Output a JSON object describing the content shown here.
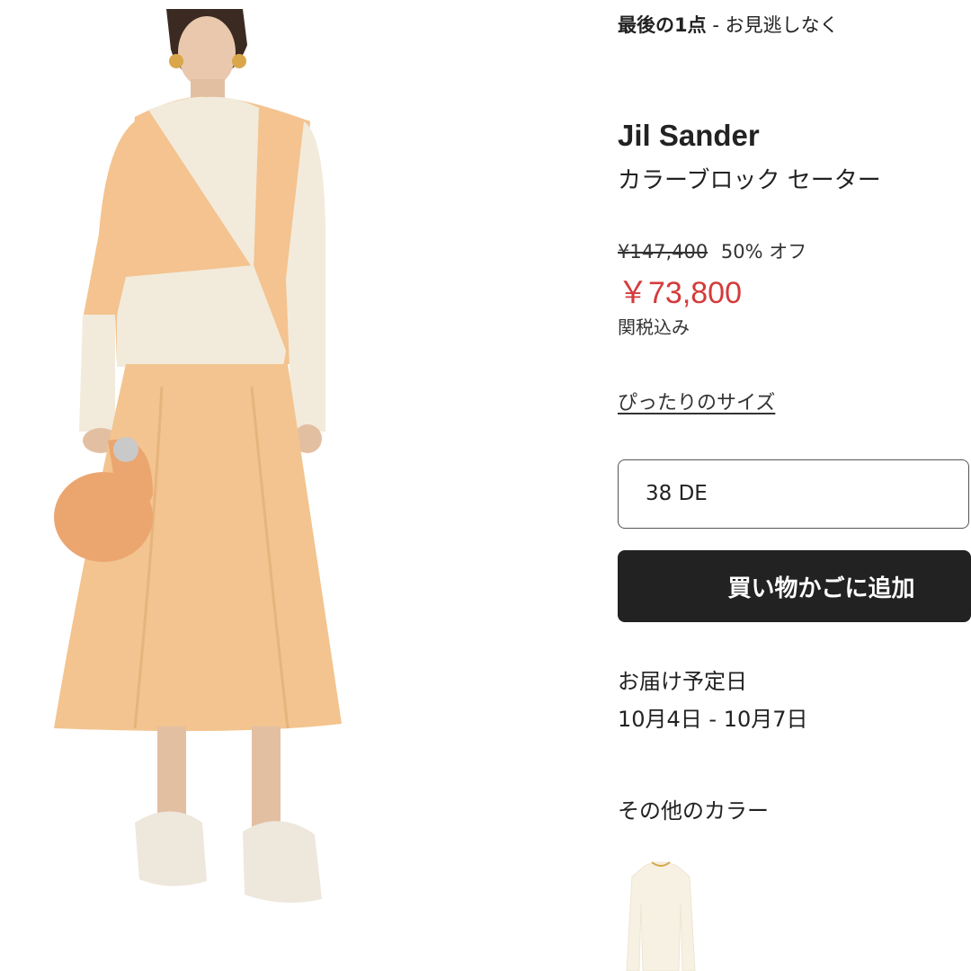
{
  "product_image": {
    "alt": "Jil Sander カラーブロック セーター",
    "colors": {
      "sweater_orange": "#f4c38f",
      "sweater_cream": "#f2ebdc",
      "skirt": "#f3c48f",
      "bag": "#eba670",
      "shoes": "#eee7dc"
    }
  },
  "urgency": {
    "strong": "最後の1点",
    "rest": "- お見逃しなく"
  },
  "product": {
    "brand": "Jil Sander",
    "name": "カラーブロック セーター"
  },
  "price": {
    "original": "¥147,400",
    "discount": "50% オフ",
    "sale": "￥73,800",
    "sale_color": "#d43b3b",
    "tax_note": "関税込み"
  },
  "size_guide": {
    "label": "ぴったりのサイズ"
  },
  "size_select": {
    "value": "38 DE"
  },
  "add_to_bag": {
    "label": "買い物かごに追加",
    "color": "#222222"
  },
  "delivery": {
    "label": "お届け予定日",
    "dates": "10月4日 - 10月7日"
  },
  "other_colors": {
    "label": "その他のカラー",
    "swatches": [
      {
        "color_name": "cream",
        "hex": "#f7f1e3"
      }
    ]
  }
}
